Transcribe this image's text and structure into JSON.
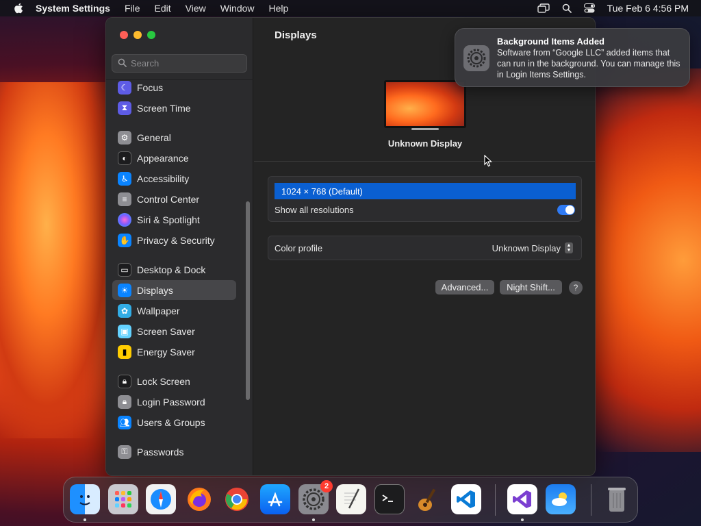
{
  "menubar": {
    "app_name": "System Settings",
    "menus": [
      "File",
      "Edit",
      "View",
      "Window",
      "Help"
    ],
    "datetime": "Tue Feb 6  4:56 PM"
  },
  "sidebar": {
    "search_placeholder": "Search",
    "items": [
      {
        "label": "Focus",
        "icon": "moon-icon",
        "color": "#5e5ce6"
      },
      {
        "label": "Screen Time",
        "icon": "hourglass-icon",
        "color": "#5e5ce6"
      },
      {
        "label": "General",
        "icon": "gear-icon",
        "color": "#8e8e93"
      },
      {
        "label": "Appearance",
        "icon": "appearance-icon",
        "color": "#1c1c1e"
      },
      {
        "label": "Accessibility",
        "icon": "accessibility-icon",
        "color": "#0a84ff"
      },
      {
        "label": "Control Center",
        "icon": "control-center-icon",
        "color": "#8e8e93"
      },
      {
        "label": "Siri & Spotlight",
        "icon": "siri-icon",
        "color": "#bf5af2"
      },
      {
        "label": "Privacy & Security",
        "icon": "hand-icon",
        "color": "#0a84ff"
      },
      {
        "label": "Desktop & Dock",
        "icon": "dock-icon",
        "color": "#1c1c1e"
      },
      {
        "label": "Displays",
        "icon": "sun-icon",
        "color": "#0a84ff"
      },
      {
        "label": "Wallpaper",
        "icon": "flower-icon",
        "color": "#32ade6"
      },
      {
        "label": "Screen Saver",
        "icon": "screen-saver-icon",
        "color": "#64d2ff"
      },
      {
        "label": "Energy Saver",
        "icon": "battery-icon",
        "color": "#ffcc00"
      },
      {
        "label": "Lock Screen",
        "icon": "lock-icon",
        "color": "#1c1c1e"
      },
      {
        "label": "Login Password",
        "icon": "lock-icon",
        "color": "#8e8e93"
      },
      {
        "label": "Users & Groups",
        "icon": "users-icon",
        "color": "#0a84ff"
      },
      {
        "label": "Passwords",
        "icon": "key-icon",
        "color": "#8e8e93"
      }
    ]
  },
  "main": {
    "title": "Displays",
    "display_name": "Unknown Display",
    "resolution": "1024 × 768 (Default)",
    "show_all_label": "Show all resolutions",
    "color_profile_label": "Color profile",
    "color_profile_value": "Unknown Display",
    "advanced_label": "Advanced...",
    "night_shift_label": "Night Shift...",
    "help_label": "?"
  },
  "notification": {
    "title": "Background Items Added",
    "body": "Software from “Google LLC” added items that can run in the background. You can manage this in Login Items Settings."
  },
  "dock": {
    "badge_count": "2",
    "apps": [
      "finder",
      "launchpad",
      "safari",
      "firefox",
      "chrome",
      "app-store",
      "system-settings",
      "textedit",
      "terminal",
      "garageband",
      "vscode",
      "visual-studio",
      "weather",
      "trash"
    ]
  }
}
